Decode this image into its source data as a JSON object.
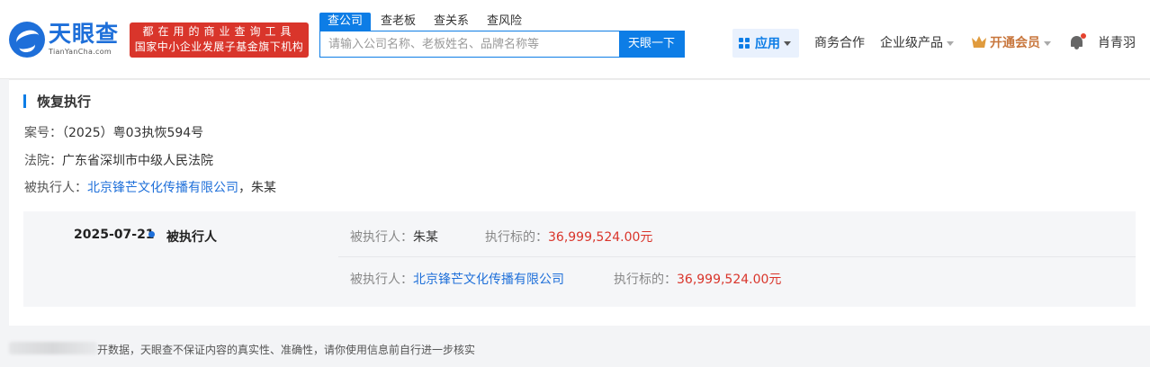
{
  "header": {
    "logo_title": "天眼查",
    "logo_sub": "TianYanCha.com",
    "promo_line1": "都在用的商业查询工具",
    "promo_line2": "国家中小企业发展子基金旗下机构",
    "search_tabs": [
      "查公司",
      "查老板",
      "查关系",
      "查风险"
    ],
    "search_placeholder": "请输入公司名称、老板姓名、品牌名称等",
    "search_button": "天眼一下",
    "nav": {
      "app": "应用",
      "business": "商务合作",
      "enterprise": "企业级产品",
      "vip": "开通会员",
      "user": "肖青羽"
    }
  },
  "section": {
    "title": "恢复执行",
    "case_label": "案号：",
    "case_value": "（2025）粤03执恢594号",
    "court_label": "法院：",
    "court_value": "广东省深圳市中级人民法院",
    "executed_label": "被执行人：",
    "executed_company": "北京锋芒文化传播有限公司",
    "executed_sep": "，",
    "executed_person": "朱某"
  },
  "detail": {
    "date": "2025-07-21",
    "type": "被执行人",
    "rows": [
      {
        "party_label": "被执行人：",
        "party": "朱某",
        "amount_label": "执行标的：",
        "amount": "36,999,524.00元"
      },
      {
        "party_label": "被执行人：",
        "party": "北京锋芒文化传播有限公司",
        "amount_label": "执行标的：",
        "amount": "36,999,524.00元"
      }
    ]
  },
  "footer": {
    "text": "开数据，天眼查不保证内容的真实性、准确性，请你使用信息前自行进一步核实"
  }
}
